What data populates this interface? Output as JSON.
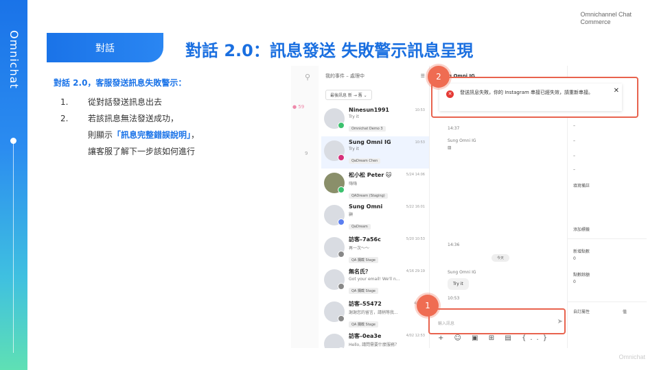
{
  "brand": {
    "vertical": "Omnichat",
    "corner": [
      "Omnichannel Chat",
      "Commerce"
    ],
    "footer": "Omnichat"
  },
  "pill": {
    "label": "對話"
  },
  "title": "對話 2.0：訊息發送 失敗警示訊息呈現",
  "left": {
    "heading": "對話 2.0，客服發送訊息失敗警示：",
    "items": [
      {
        "num": "1.",
        "text": "從對話發送訊息出去"
      },
      {
        "num": "2.",
        "line1": "若該訊息無法發送成功，",
        "line2_pre": "則顯示",
        "line2_hl": "「訊息完整錯誤說明」",
        "line2_post": "，",
        "line3": "讓客服了解下一步該如何進行"
      }
    ]
  },
  "app": {
    "list_header": "我的事件 – 處理中",
    "list_filter": "最後訊息 新 → 舊 ⌄",
    "conversations": [
      {
        "name": "Ninesun1991",
        "time": "10:53",
        "preview": "Try it",
        "tag": "Omnichat Demo 3",
        "channel_color": "#3cc16e",
        "active": false
      },
      {
        "name": "Sung Omni IG",
        "time": "10:53",
        "preview": "Try it",
        "tag": "QaDream Chen",
        "channel_color": "#d6307a",
        "active": true
      },
      {
        "name": "松小松 Peter 🐱",
        "time": "5/24 14:06",
        "preview": "嗨嗨",
        "tag": "QADream (Staging)",
        "channel_color": "#3cc16e",
        "active": false
      },
      {
        "name": "Sung Omni",
        "time": "5/22 16:01",
        "preview": "顥",
        "tag": "QaDream",
        "channel_color": "#5a7ef0",
        "active": false
      },
      {
        "name": "訪客–7a56c",
        "time": "5/20 10:53",
        "preview": "再一次～～",
        "tag": "QA 攔截 Stage",
        "channel_color": "#888888",
        "active": false
      },
      {
        "name": "無名氏？",
        "time": "4/16 29:19",
        "preview": "Got your email! We'll n...",
        "tag": "QA 攔截 Stage",
        "channel_color": "#888888",
        "active": false
      },
      {
        "name": "訪客–55472",
        "time": "4/09 0",
        "preview": "謝謝您的留言，請稍等我...",
        "tag": "QA 攔截 Stage",
        "channel_color": "#888888",
        "active": false
      },
      {
        "name": "訪客–0ea3e",
        "time": "4/02 12:53",
        "preview": "Hello, 請問需要什麼服務？",
        "tag": "",
        "channel_color": "#888888",
        "active": false
      }
    ],
    "chat_header": "Sung Omni IG",
    "chat_time1": "14:37",
    "chat_sender1": "Sung Omni IG",
    "chat_time2": "14:36",
    "day_label": "今天",
    "chat_sender2": "Sung Omni IG",
    "chat_bubble": "Try it",
    "chat_time3": "10:53",
    "input_placeholder": "輸入訊息",
    "toolbar_icons": "+ ☺ ▣ ⊞ ▤ {..}",
    "info": {
      "dash1": "–",
      "dash2": "–",
      "dash3": "–",
      "dash4": "–",
      "note": "填寫備註",
      "add_tag": "添加標籤",
      "new_visits": "新增點數",
      "new_visits_val": "0",
      "points": "點數餘額",
      "points_val": "0",
      "custom": "自訂屬性",
      "value": "值"
    }
  },
  "error": {
    "message": "發送訊息失敗，你的 Instagram 串接已經失效，請重新串接。",
    "close": "✕"
  },
  "steps": {
    "one": "1",
    "two": "2"
  },
  "colors": {
    "accent": "#1a73e8",
    "error": "#e8624d"
  }
}
